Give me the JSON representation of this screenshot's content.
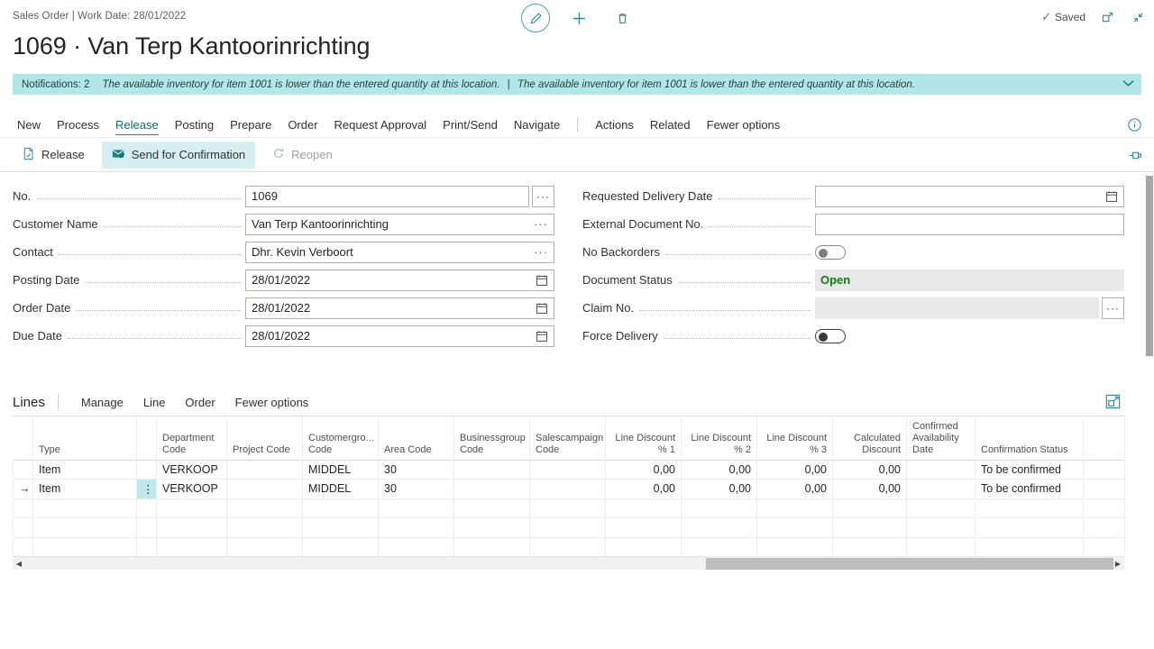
{
  "window": {
    "breadcrumb": "Sales Order | Work Date: 28/01/2022",
    "title": "1069 · Van Terp Kantoorinrichting",
    "saved_label": "Saved",
    "check_glyph": "✓"
  },
  "top_icons": {
    "edit": "edit-pencil-icon",
    "new": "plus-icon",
    "delete": "trash-icon",
    "open_new_window": "open-in-new-window-icon",
    "collapse": "collapse-icon"
  },
  "notification": {
    "count_label": "Notifications: 2",
    "message_1": "The available inventory for item 1001 is lower than the entered quantity at this location.",
    "separator": "|",
    "message_2": "The available inventory for item 1001 is lower than the entered quantity at this location.",
    "chevron": "chevron-down-icon"
  },
  "action_menu": {
    "items": [
      {
        "label": "New",
        "active": false
      },
      {
        "label": "Process",
        "active": false
      },
      {
        "label": "Release",
        "active": true
      },
      {
        "label": "Posting",
        "active": false
      },
      {
        "label": "Prepare",
        "active": false
      },
      {
        "label": "Order",
        "active": false
      },
      {
        "label": "Request Approval",
        "active": false
      },
      {
        "label": "Print/Send",
        "active": false
      },
      {
        "label": "Navigate",
        "active": false
      }
    ],
    "items_right": [
      {
        "label": "Actions"
      },
      {
        "label": "Related"
      },
      {
        "label": "Fewer options"
      }
    ]
  },
  "ribbon": {
    "release": "Release",
    "send_for_confirmation": "Send for Confirmation",
    "reopen": "Reopen"
  },
  "card": {
    "left": [
      {
        "label": "No.",
        "value": "1069",
        "control": "text-assist-button",
        "assist": "···"
      },
      {
        "label": "Customer Name",
        "value": "Van Terp Kantoorinrichting",
        "control": "text-inline-assist",
        "assist": "···"
      },
      {
        "label": "Contact",
        "value": "Dhr. Kevin Verboort",
        "control": "text-inline-assist",
        "assist": "···"
      },
      {
        "label": "Posting Date",
        "value": "28/01/2022",
        "control": "date"
      },
      {
        "label": "Order Date",
        "value": "28/01/2022",
        "control": "date"
      },
      {
        "label": "Due Date",
        "value": "28/01/2022",
        "control": "date"
      }
    ],
    "right": [
      {
        "label": "Requested Delivery Date",
        "value": "",
        "control": "date"
      },
      {
        "label": "External Document No.",
        "value": "",
        "control": "text"
      },
      {
        "label": "No Backorders",
        "value": "off",
        "control": "toggle"
      },
      {
        "label": "Document Status",
        "value": "Open",
        "control": "readonly-status"
      },
      {
        "label": "Claim No.",
        "value": "",
        "control": "readonly-assist",
        "assist": "···"
      },
      {
        "label": "Force Delivery",
        "value": "off",
        "control": "toggle-focused"
      }
    ]
  },
  "lines": {
    "title": "Lines",
    "menu": [
      "Manage",
      "Line",
      "Order",
      "Fewer options"
    ],
    "expand_icon": "expand-grid-icon",
    "columns": [
      {
        "label": "",
        "align": "left"
      },
      {
        "label": "Type",
        "align": "left"
      },
      {
        "label": "",
        "align": "left"
      },
      {
        "label": "Department Code",
        "align": "left"
      },
      {
        "label": "Project Code",
        "align": "left"
      },
      {
        "label": "Customergro... Code",
        "align": "left"
      },
      {
        "label": "Area Code",
        "align": "left"
      },
      {
        "label": "Businessgroup Code",
        "align": "left"
      },
      {
        "label": "Salescampaign Code",
        "align": "left"
      },
      {
        "label": "Line Discount % 1",
        "align": "right"
      },
      {
        "label": "Line Discount % 2",
        "align": "right"
      },
      {
        "label": "Line Discount % 3",
        "align": "right"
      },
      {
        "label": "Calculated Discount",
        "align": "right"
      },
      {
        "label": "Confirmed Availability Date",
        "align": "left"
      },
      {
        "label": "Confirmation Status",
        "align": "left"
      },
      {
        "label": "",
        "align": "left"
      }
    ],
    "rows": [
      {
        "selected": false,
        "cells": [
          "",
          "Item",
          "",
          "VERKOOP",
          "",
          "MIDDEL",
          "30",
          "",
          "",
          "0,00",
          "0,00",
          "0,00",
          "0,00",
          "",
          "To be confirmed",
          ""
        ]
      },
      {
        "selected": true,
        "arrow": "→",
        "menu_glyph": "⋮",
        "cells": [
          "→",
          "Item",
          "⋮",
          "VERKOOP",
          "",
          "MIDDEL",
          "30",
          "",
          "",
          "0,00",
          "0,00",
          "0,00",
          "0,00",
          "",
          "To be confirmed",
          ""
        ]
      },
      {
        "selected": false,
        "empty": true,
        "cells": [
          "",
          "",
          "",
          "",
          "",
          "",
          "",
          "",
          "",
          "",
          "",
          "",
          "",
          "",
          "",
          ""
        ]
      },
      {
        "selected": false,
        "empty": true,
        "cells": [
          "",
          "",
          "",
          "",
          "",
          "",
          "",
          "",
          "",
          "",
          "",
          "",
          "",
          "",
          "",
          ""
        ]
      },
      {
        "selected": false,
        "empty": true,
        "cells": [
          "",
          "",
          "",
          "",
          "",
          "",
          "",
          "",
          "",
          "",
          "",
          "",
          "",
          "",
          "",
          ""
        ]
      }
    ]
  },
  "scrollbars": {
    "h_left_arrow": "◀",
    "h_right_arrow": "▶"
  },
  "colors": {
    "accent_teal": "#2d8a94",
    "notification_bg": "#b3e7e7",
    "highlight_bg": "#d7eff0",
    "status_green": "#107c10",
    "selected_cell": "#bfe8ea"
  }
}
